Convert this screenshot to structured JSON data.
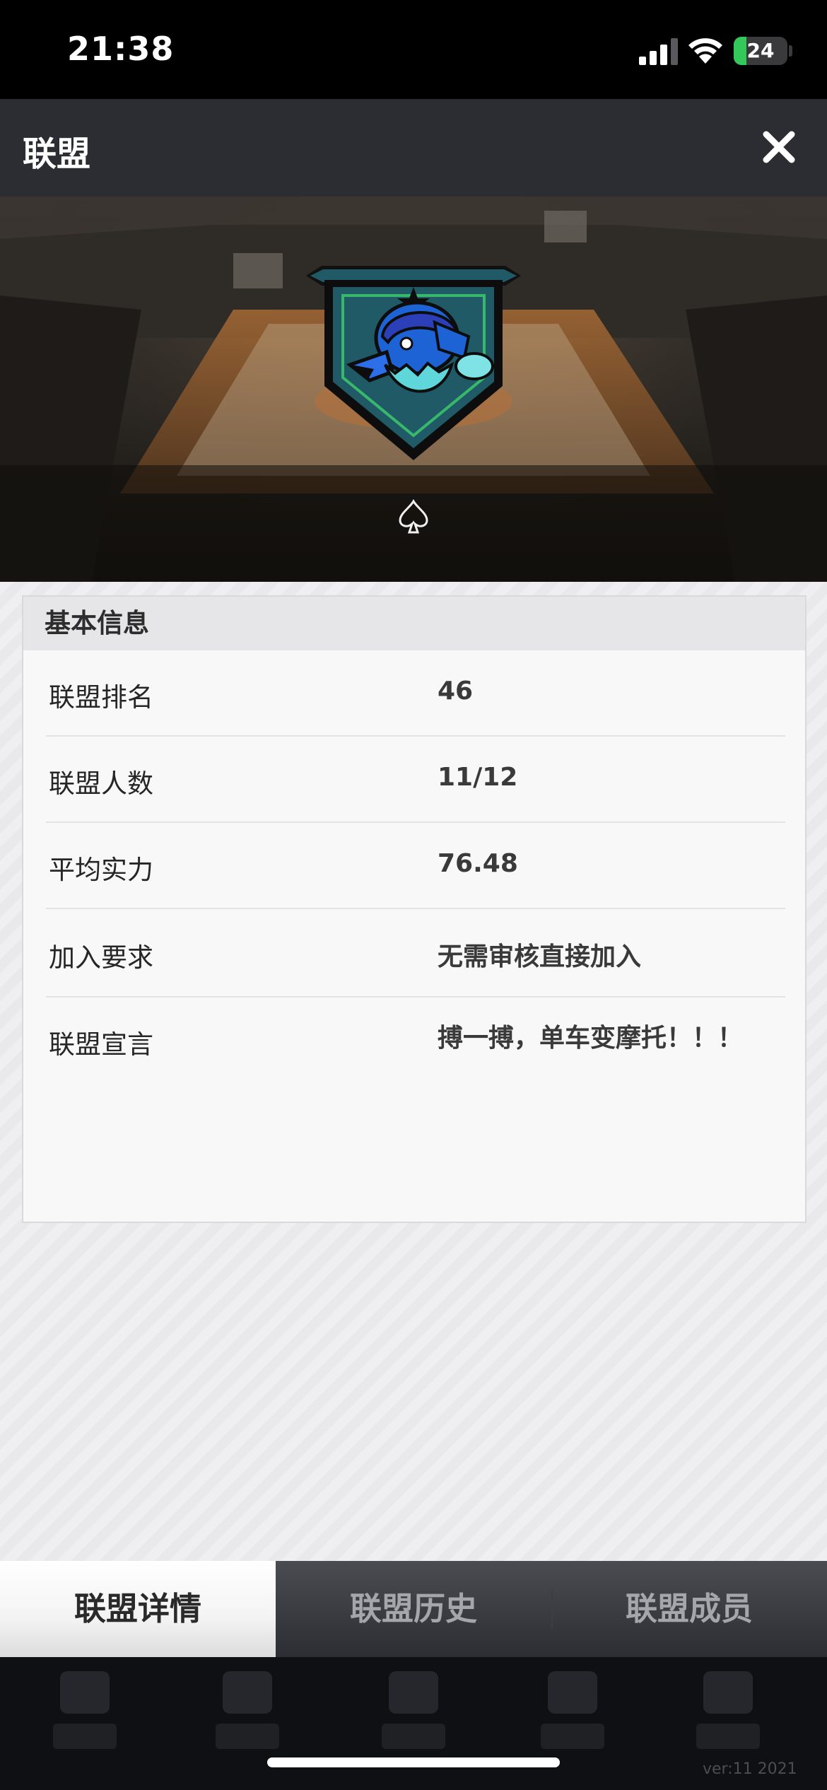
{
  "status_bar": {
    "time": "21:38",
    "battery_level": "24",
    "battery_fraction": 0.24,
    "icons": [
      "signal-icon",
      "wifi-icon",
      "battery-icon"
    ]
  },
  "header": {
    "title": "联盟",
    "close_icon": "close-icon"
  },
  "hero": {
    "badge_icon": "eagle-shield-logo",
    "rank_icon": "spade-icon"
  },
  "info_card": {
    "title": "基本信息",
    "rows": [
      {
        "label": "联盟排名",
        "value": "46"
      },
      {
        "label": "联盟人数",
        "value": "11/12"
      },
      {
        "label": "平均实力",
        "value": "76.48"
      },
      {
        "label": "加入要求",
        "value": "无需审核直接加入"
      },
      {
        "label": "联盟宣言",
        "value": "搏一搏，单车变摩托！！！"
      }
    ]
  },
  "tabs": [
    {
      "label": "联盟详情",
      "active": true
    },
    {
      "label": "联盟历史",
      "active": false
    },
    {
      "label": "联盟成员",
      "active": false
    }
  ],
  "footer": {
    "version": "ver:11  2021"
  },
  "colors": {
    "header_bg": "#2b2d33",
    "badge_teal": "#1f5a66",
    "badge_blue": "#1e63d6",
    "badge_green": "#38b86b"
  }
}
